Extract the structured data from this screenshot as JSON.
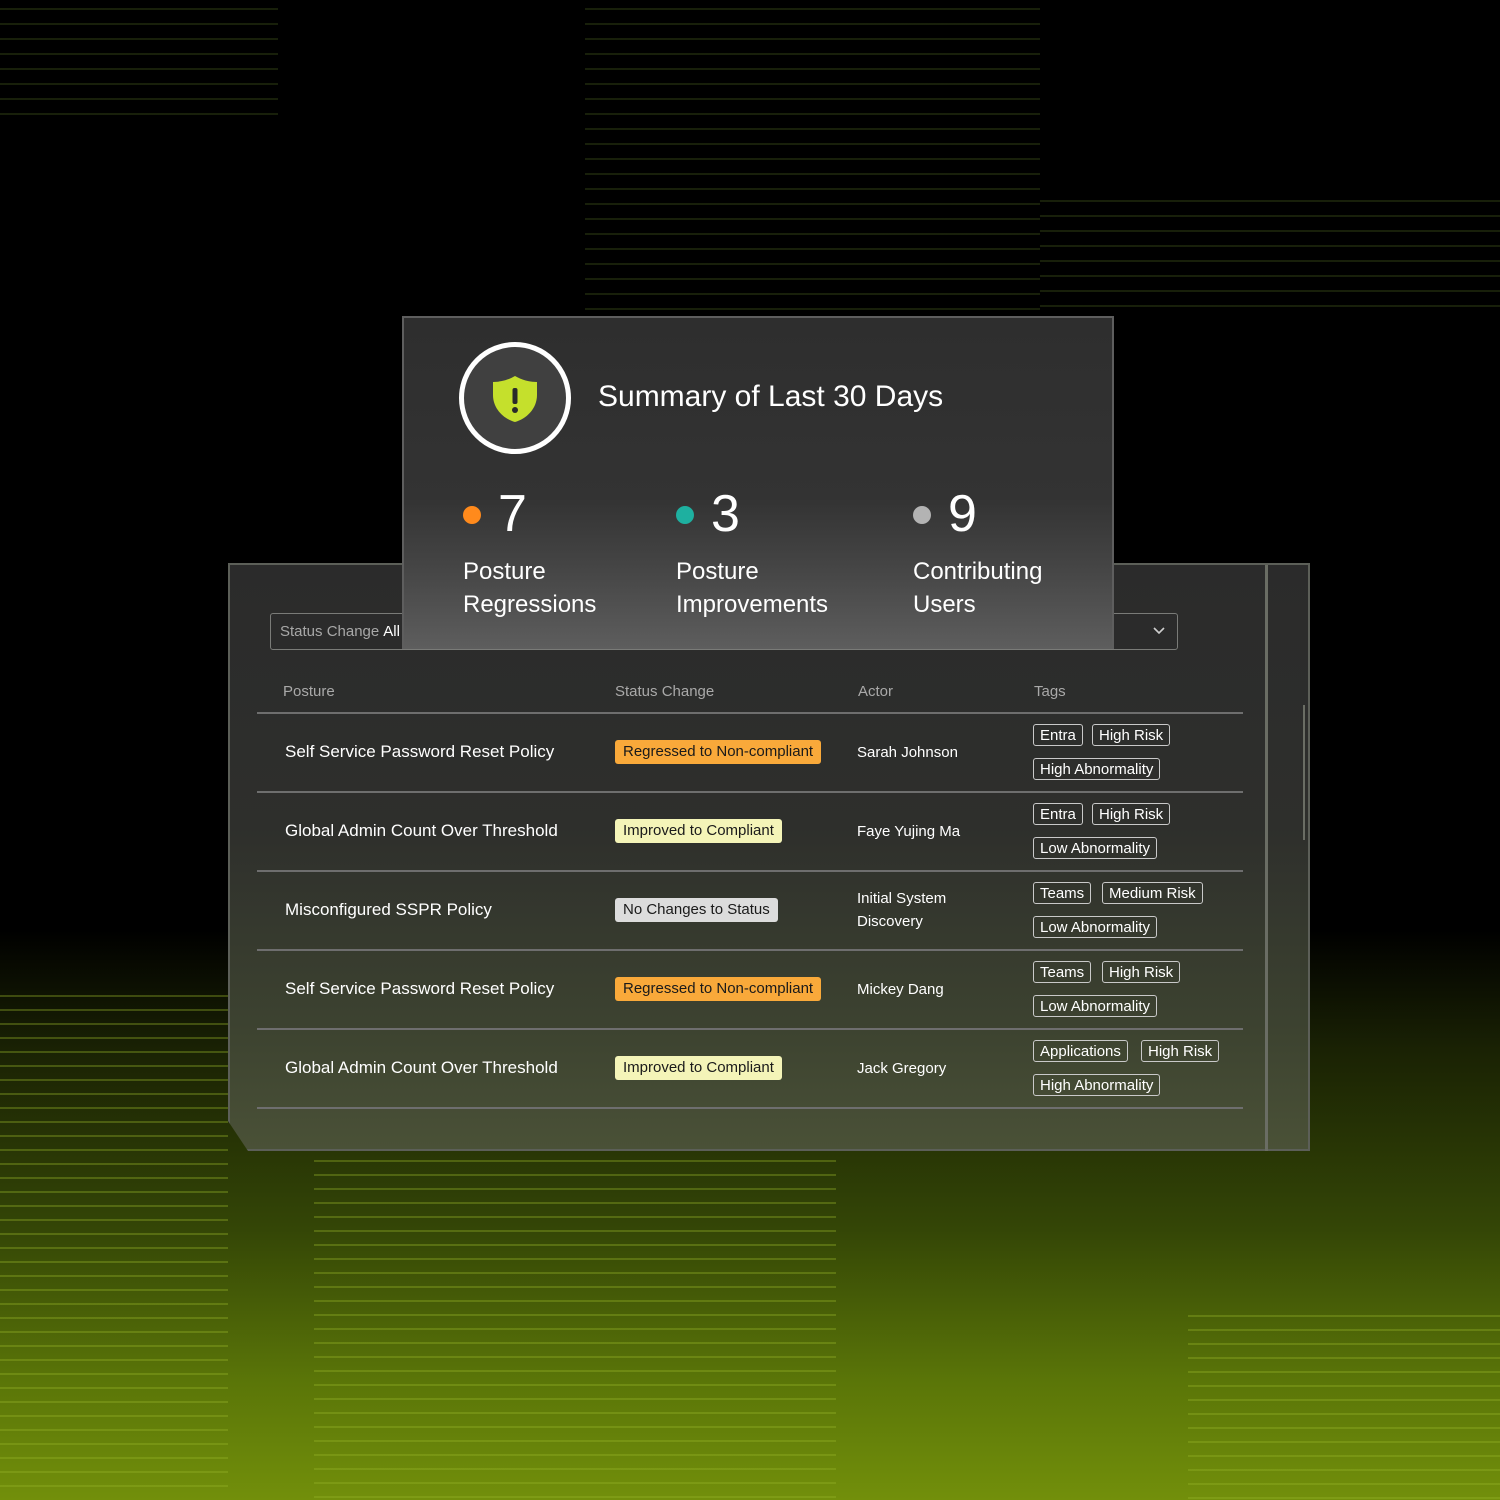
{
  "summary": {
    "title": "Summary of Last 30 Days",
    "icon": "shield-alert-icon",
    "stats": [
      {
        "value": "7",
        "label_line1": "Posture",
        "label_line2": "Regressions",
        "color": "#ff8a1c"
      },
      {
        "value": "3",
        "label_line1": "Posture",
        "label_line2": "Improvements",
        "color": "#1eb0a0"
      },
      {
        "value": "9",
        "label_line1": "Contributing",
        "label_line2": "Users",
        "color": "#b3b3b3"
      }
    ]
  },
  "filter": {
    "label": "Status Change",
    "value": "All"
  },
  "table": {
    "headers": [
      "Posture",
      "Status Change",
      "Actor",
      "Tags"
    ],
    "rows": [
      {
        "posture": "Self Service Password Reset Policy",
        "status": "Regressed to Non-compliant",
        "status_type": "regressed",
        "actor": "Sarah Johnson",
        "tags": [
          "Entra",
          "High Risk",
          "High Abnormality"
        ]
      },
      {
        "posture": "Global Admin Count Over Threshold",
        "status": "Improved to Compliant",
        "status_type": "improved",
        "actor": "Faye Yujing Ma",
        "tags": [
          "Entra",
          "High Risk",
          "Low Abnormality"
        ]
      },
      {
        "posture": "Misconfigured SSPR Policy",
        "status": "No Changes to Status",
        "status_type": "none",
        "actor": "Initial System Discovery",
        "tags": [
          "Teams",
          "Medium Risk",
          "Low Abnormality"
        ]
      },
      {
        "posture": "Self Service Password Reset Policy",
        "status": "Regressed to Non-compliant",
        "status_type": "regressed",
        "actor": "Mickey Dang",
        "tags": [
          "Teams",
          "High Risk",
          "Low Abnormality"
        ]
      },
      {
        "posture": "Global Admin Count Over Threshold",
        "status": "Improved to Compliant",
        "status_type": "improved",
        "actor": "Jack Gregory",
        "tags": [
          "Applications",
          "High Risk",
          "High Abnormality"
        ]
      }
    ]
  },
  "colors": {
    "regressed": "#f9a93a",
    "improved": "#f4f4b8",
    "none": "#dcdcdc",
    "shield": "#c5e02c"
  }
}
